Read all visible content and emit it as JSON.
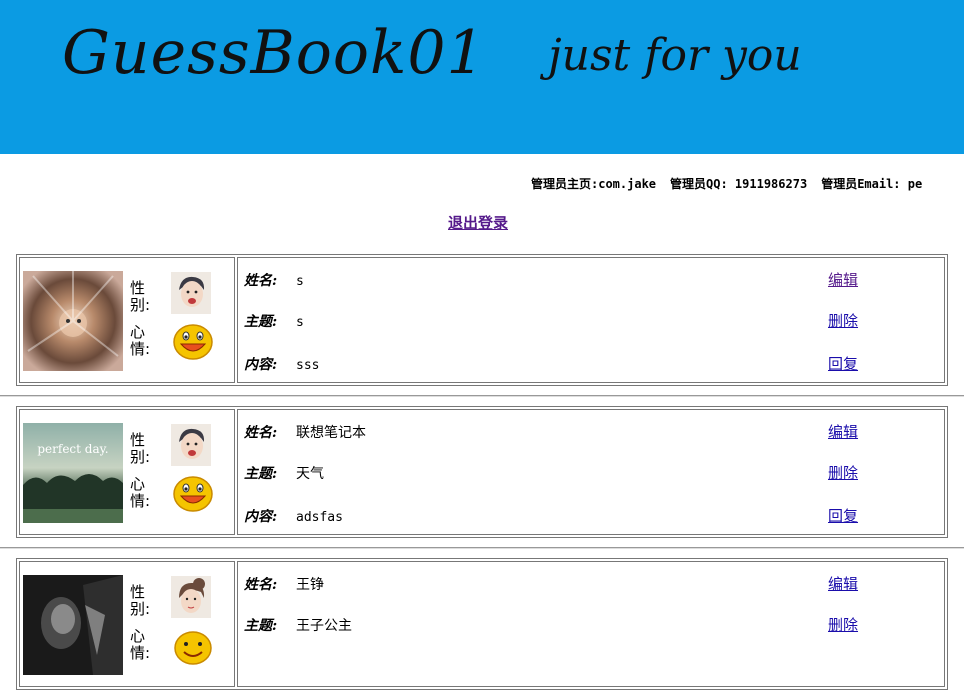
{
  "banner": {
    "title": "GuessBook01",
    "subtitle": "just for you"
  },
  "admin": {
    "homepage": "管理员主页:com.jake",
    "qq": "管理员QQ: 1911986273",
    "email": "管理员Email: pe"
  },
  "logout_label": "退出登录",
  "labels": {
    "gender": "性别:",
    "mood": "心情:",
    "name": "姓名:",
    "subject": "主题:",
    "content": "内容:",
    "edit": "编辑",
    "delete": "删除",
    "reply": "回复"
  },
  "entries": [
    {
      "name": "s",
      "subject": "s",
      "content": "sss",
      "photo_icon": "blurred-face-photo",
      "avatar_icon": "boy-avatar-icon",
      "mood_icon": "grin-smiley-icon"
    },
    {
      "name": "联想笔记本",
      "subject": "天气",
      "content": "adsfas",
      "photo_icon": "perfect-day-photo",
      "photo_text": "perfect day.",
      "avatar_icon": "boy-avatar-icon",
      "mood_icon": "grin-smiley-icon"
    },
    {
      "name": "王铮",
      "subject": "王子公主",
      "content": "",
      "photo_icon": "dark-portrait-photo",
      "avatar_icon": "girl-avatar-icon",
      "mood_icon": "smiley-icon"
    }
  ],
  "colors": {
    "banner": "#0b9be3",
    "link": "#1a0dab",
    "visited": "#551a8b"
  }
}
